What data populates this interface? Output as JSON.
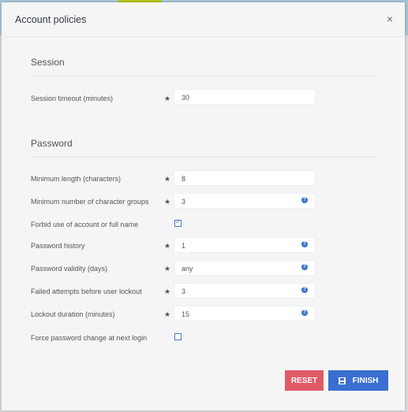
{
  "dialog": {
    "title": "Account policies",
    "close_symbol": "×"
  },
  "session": {
    "heading": "Session",
    "fields": [
      {
        "label": "Session timeout (minutes)",
        "required": true,
        "value": "30",
        "help": false
      }
    ]
  },
  "password": {
    "heading": "Password",
    "fields": [
      {
        "label": "Minimum length (characters)",
        "required": true,
        "value": "8",
        "help": false
      },
      {
        "label": "Minimum number of character groups",
        "required": true,
        "value": "3",
        "help": true
      },
      {
        "label": "Forbid use of account or full name",
        "type": "checkbox",
        "checked": true
      },
      {
        "label": "Password history",
        "required": true,
        "value": "1",
        "help": true
      },
      {
        "label": "Password validity (days)",
        "required": true,
        "value": "any",
        "help": true
      },
      {
        "label": "Failed attempts before user lockout",
        "required": true,
        "value": "3",
        "help": true
      },
      {
        "label": "Lockout duration (minutes)",
        "required": true,
        "value": "15",
        "help": true
      },
      {
        "label": "Force password change at next login",
        "type": "checkbox",
        "checked": false
      }
    ]
  },
  "symbols": {
    "required": "★",
    "help": "?",
    "check": "✓"
  },
  "buttons": {
    "reset": "RESET",
    "finish": "FINISH"
  },
  "colors": {
    "reset": "#e05a66",
    "finish": "#3a6fd1",
    "help_icon": "#3c75c9"
  }
}
